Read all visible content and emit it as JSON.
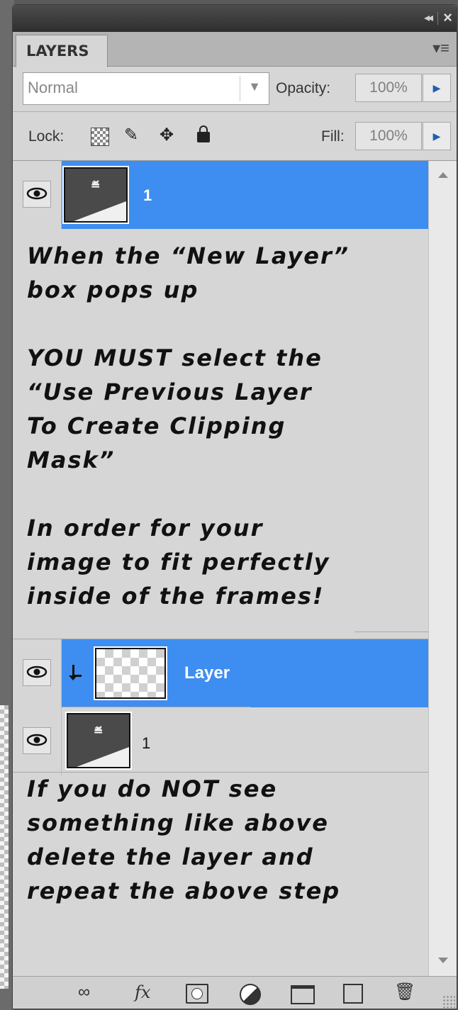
{
  "panel": {
    "tab_label": "LAYERS",
    "blend_mode": "Normal",
    "opacity_label": "Opacity:",
    "opacity_value": "100%",
    "lock_label": "Lock:",
    "fill_label": "Fill:",
    "fill_value": "100%"
  },
  "layers": [
    {
      "name": "1",
      "selected": true,
      "visible": true
    },
    {
      "name": "Layer",
      "selected": true,
      "visible": true,
      "clipping_mask": true
    },
    {
      "name": "1",
      "selected": false,
      "visible": true
    }
  ],
  "instructions": {
    "block1": "When the “New Layer”\nbox pops up",
    "block2": "YOU MUST select the\n“Use Previous Layer\nTo Create Clipping\nMask”",
    "block3": "In order for your\nimage to fit perfectly\ninside of the frames!",
    "block4": "If you do NOT see\nsomething like above\ndelete the layer and\nrepeat the above step"
  },
  "colors": {
    "selection": "#3d8ef0",
    "panel_bg": "#d6d6d6",
    "titlebar": "#3a3a3a"
  },
  "icons": {
    "bottom_bar": [
      "link-icon",
      "fx-icon",
      "add-mask-icon",
      "adjustment-layer-icon",
      "new-group-icon",
      "new-layer-icon",
      "trash-icon"
    ]
  }
}
